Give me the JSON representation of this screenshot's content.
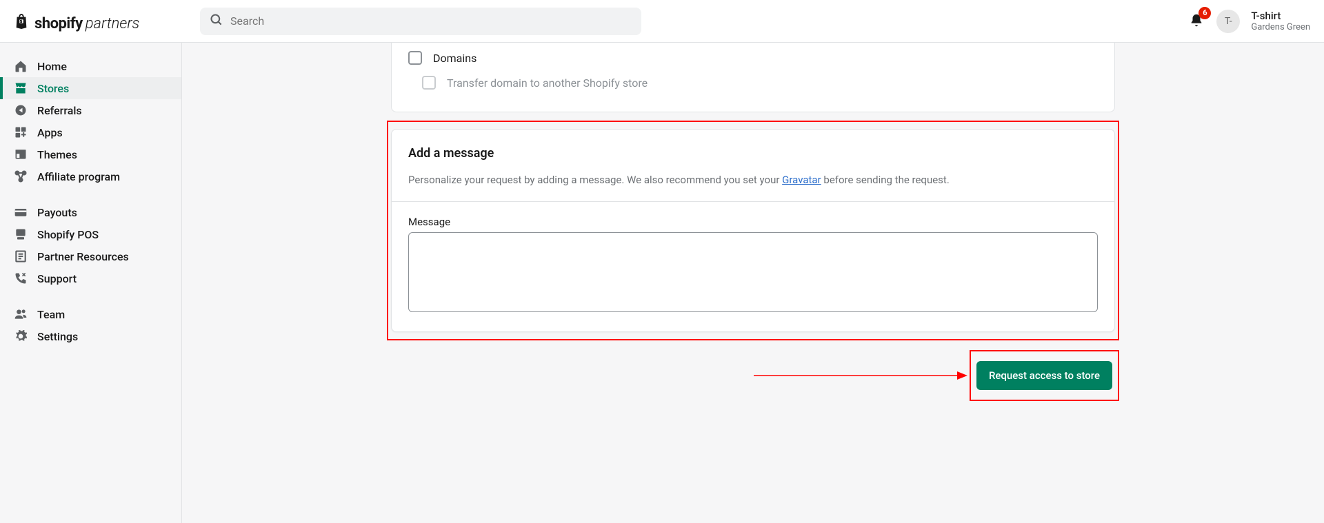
{
  "header": {
    "logo_shopify": "shopify",
    "logo_partners": "partners",
    "search_placeholder": "Search",
    "notification_count": "6",
    "avatar_initials": "T-",
    "user_name": "T-shirt",
    "user_sub": "Gardens Green"
  },
  "sidebar": {
    "items": [
      {
        "label": "Home"
      },
      {
        "label": "Stores"
      },
      {
        "label": "Referrals"
      },
      {
        "label": "Apps"
      },
      {
        "label": "Themes"
      },
      {
        "label": "Affiliate program"
      },
      {
        "label": "Payouts"
      },
      {
        "label": "Shopify POS"
      },
      {
        "label": "Partner Resources"
      },
      {
        "label": "Support"
      },
      {
        "label": "Team"
      },
      {
        "label": "Settings"
      }
    ]
  },
  "permissions": {
    "domains_label": "Domains",
    "transfer_label": "Transfer domain to another Shopify store"
  },
  "message_panel": {
    "title": "Add a message",
    "desc_prefix": "Personalize your request by adding a message. We also recommend you set your ",
    "gravatar_link": "Gravatar",
    "desc_suffix": " before sending the request.",
    "field_label": "Message"
  },
  "action": {
    "primary_button": "Request access to store"
  }
}
